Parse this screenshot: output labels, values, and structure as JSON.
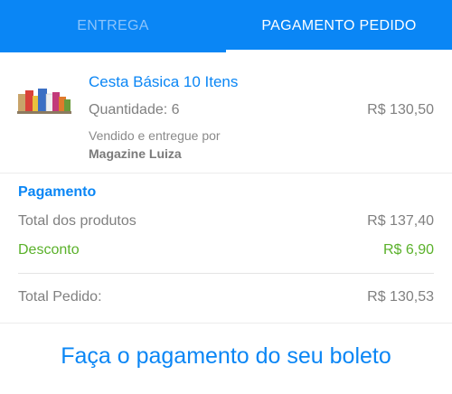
{
  "tabs": [
    {
      "label": "ENTREGA"
    },
    {
      "label": "PAGAMENTO PEDIDO"
    }
  ],
  "product": {
    "name": "Cesta Básica 10 Itens",
    "quantity": "Quantidade: 6",
    "price": "R$ 130,50",
    "sold_by": "Vendido e entregue por",
    "seller": "Magazine Luiza",
    "thumbnail_icon": "grocery-basket-image"
  },
  "payment": {
    "title": "Pagamento",
    "products_total_label": "Total dos produtos",
    "products_total_value": "R$ 137,40",
    "discount_label": "Desconto",
    "discount_value": "R$ 6,90",
    "order_total_label": "Total Pedido:",
    "order_total_value": "R$ 130,53"
  },
  "cta_label": "Faça o pagamento do seu boleto",
  "colors": {
    "brand_blue": "#0a86f5",
    "discount_green": "#5ab12a"
  }
}
